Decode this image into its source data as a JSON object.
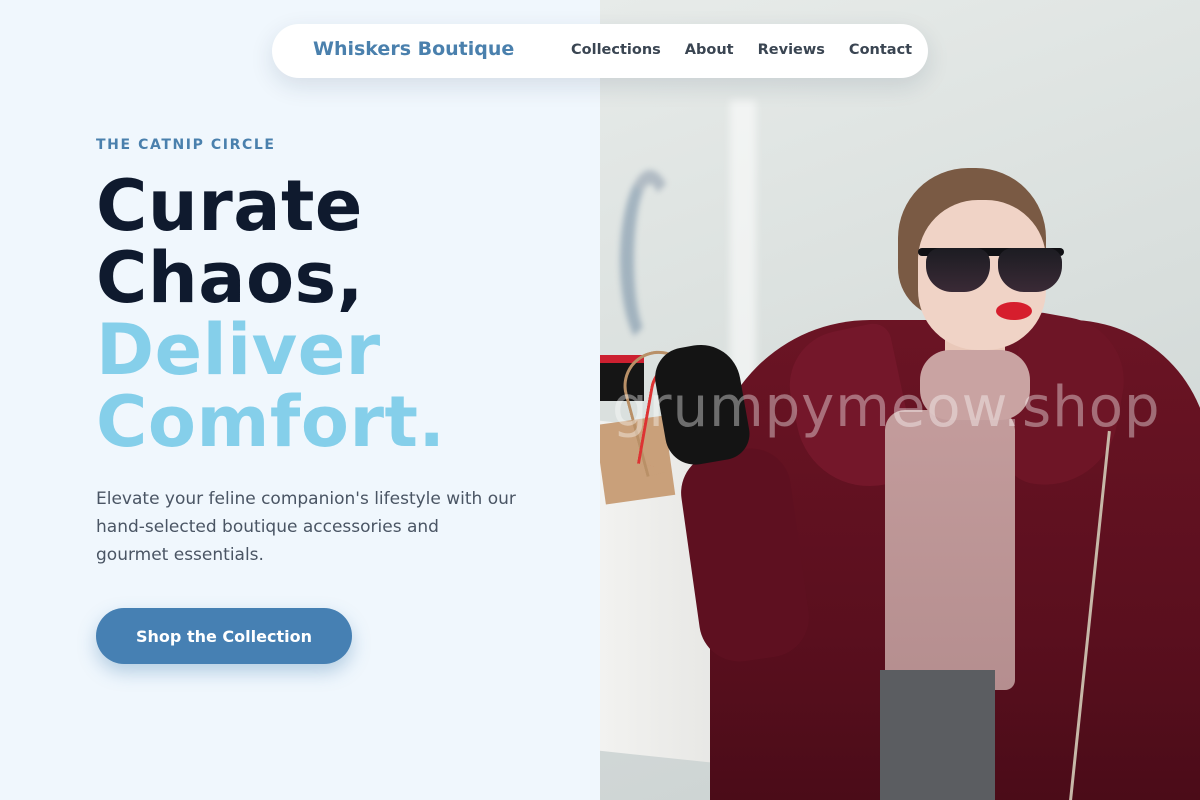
{
  "nav": {
    "brand": "Whiskers Boutique",
    "links": [
      "Collections",
      "About",
      "Reviews",
      "Contact"
    ]
  },
  "hero": {
    "eyebrow": "THE CATNIP CIRCLE",
    "headline_line1": "Curate",
    "headline_line2": "Chaos,",
    "headline_line3": "Deliver",
    "headline_line4": "Comfort.",
    "description": "Elevate your feline companion's lifestyle with our hand-selected boutique accessories and gourmet essentials.",
    "cta_label": "Shop the Collection"
  },
  "photo": {
    "watermark": "grumpymeow.shop"
  },
  "colors": {
    "brand_blue": "#4a80ad",
    "headline_dark": "#0f1a2e",
    "headline_light": "#85cfea",
    "cta_bg": "#4680b3",
    "page_bg": "#f0f7fd"
  }
}
